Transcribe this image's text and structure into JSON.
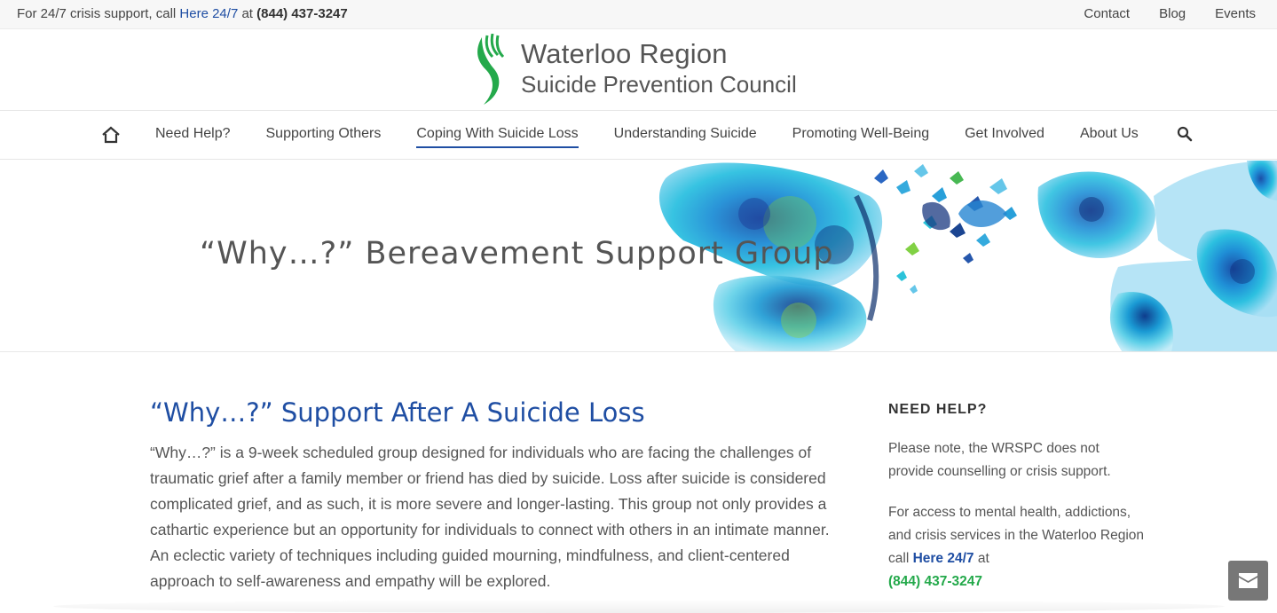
{
  "topbar": {
    "crisis_prefix": "For 24/7 crisis support, call ",
    "crisis_link": "Here 24/7",
    "crisis_mid": " at ",
    "crisis_phone": "(844) 437-3247",
    "links": [
      "Contact",
      "Blog",
      "Events"
    ]
  },
  "logo": {
    "line1": "Waterloo Region",
    "line2": "Suicide Prevention Council"
  },
  "nav": {
    "items": [
      {
        "label": "Need Help?"
      },
      {
        "label": "Supporting Others"
      },
      {
        "label": "Coping With Suicide Loss",
        "active": true
      },
      {
        "label": "Understanding Suicide"
      },
      {
        "label": "Promoting Well-Being"
      },
      {
        "label": "Get Involved"
      },
      {
        "label": "About Us"
      }
    ],
    "icons": [
      "home-icon",
      "search-icon"
    ]
  },
  "hero": {
    "title": "“Why…?” Bereavement Support Group"
  },
  "main": {
    "heading": "“Why…?” Support After A Suicide Loss",
    "body": "“Why…?” is a 9-week scheduled group designed for individuals who are facing the challenges of traumatic grief after a family member or friend has died by suicide. Loss after suicide is considered complicated grief, and as such, it is more severe and longer-lasting. This group not only provides a cathartic experience but an opportunity for individuals to connect with others in an intimate manner. An eclectic variety of techniques including guided mourning, mindfulness, and client-centered approach to self-awareness and empathy will be explored."
  },
  "sidebar": {
    "heading": "NEED HELP?",
    "note": "Please note, the WRSPC does not provide counselling or crisis support.",
    "access_prefix": "For access to mental health, addictions, and crisis services in the Waterloo Region call ",
    "access_link": "Here 24/7",
    "access_mid": " at",
    "phone": "(844) 437-3247"
  },
  "colors": {
    "brand_blue": "#1f4ea3",
    "brand_green": "#24a94b",
    "text": "#555555"
  }
}
